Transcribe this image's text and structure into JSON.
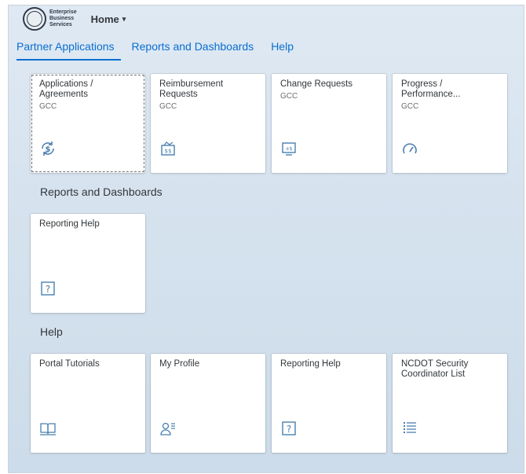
{
  "header": {
    "logo_line1": "Enterprise",
    "logo_line2": "Business",
    "logo_line3": "Services",
    "home_label": "Home",
    "home_caret": "▾"
  },
  "tabs": [
    {
      "label": "Partner Applications",
      "active": true
    },
    {
      "label": "Reports and Dashboards",
      "active": false
    },
    {
      "label": "Help",
      "active": false
    }
  ],
  "partner_applications": {
    "tiles": [
      {
        "title": "Applications / Agreements",
        "subtitle": "GCC",
        "icon": "dollar-refresh-icon"
      },
      {
        "title": "Reimbursement Requests",
        "subtitle": "GCC",
        "icon": "money-document-icon"
      },
      {
        "title": "Change Requests",
        "subtitle": "GCC",
        "icon": "monitor-dollar-icon"
      },
      {
        "title": "Progress / Performance...",
        "subtitle": "GCC",
        "icon": "gauge-icon"
      }
    ]
  },
  "reports_section": {
    "title": "Reports and Dashboards",
    "tiles": [
      {
        "title": "Reporting Help",
        "icon": "question-box-icon"
      }
    ]
  },
  "help_section": {
    "title": "Help",
    "tiles": [
      {
        "title": "Portal Tutorials",
        "icon": "open-book-icon"
      },
      {
        "title": "My Profile",
        "icon": "user-profile-icon"
      },
      {
        "title": "Reporting Help",
        "icon": "question-box-icon"
      },
      {
        "title": "NCDOT Security Coordinator List",
        "icon": "list-icon"
      }
    ]
  },
  "colors": {
    "accent": "#0a6ed1",
    "icon": "#4a7fae",
    "background_top": "#dfe9f3",
    "background_bottom": "#cddcea"
  }
}
